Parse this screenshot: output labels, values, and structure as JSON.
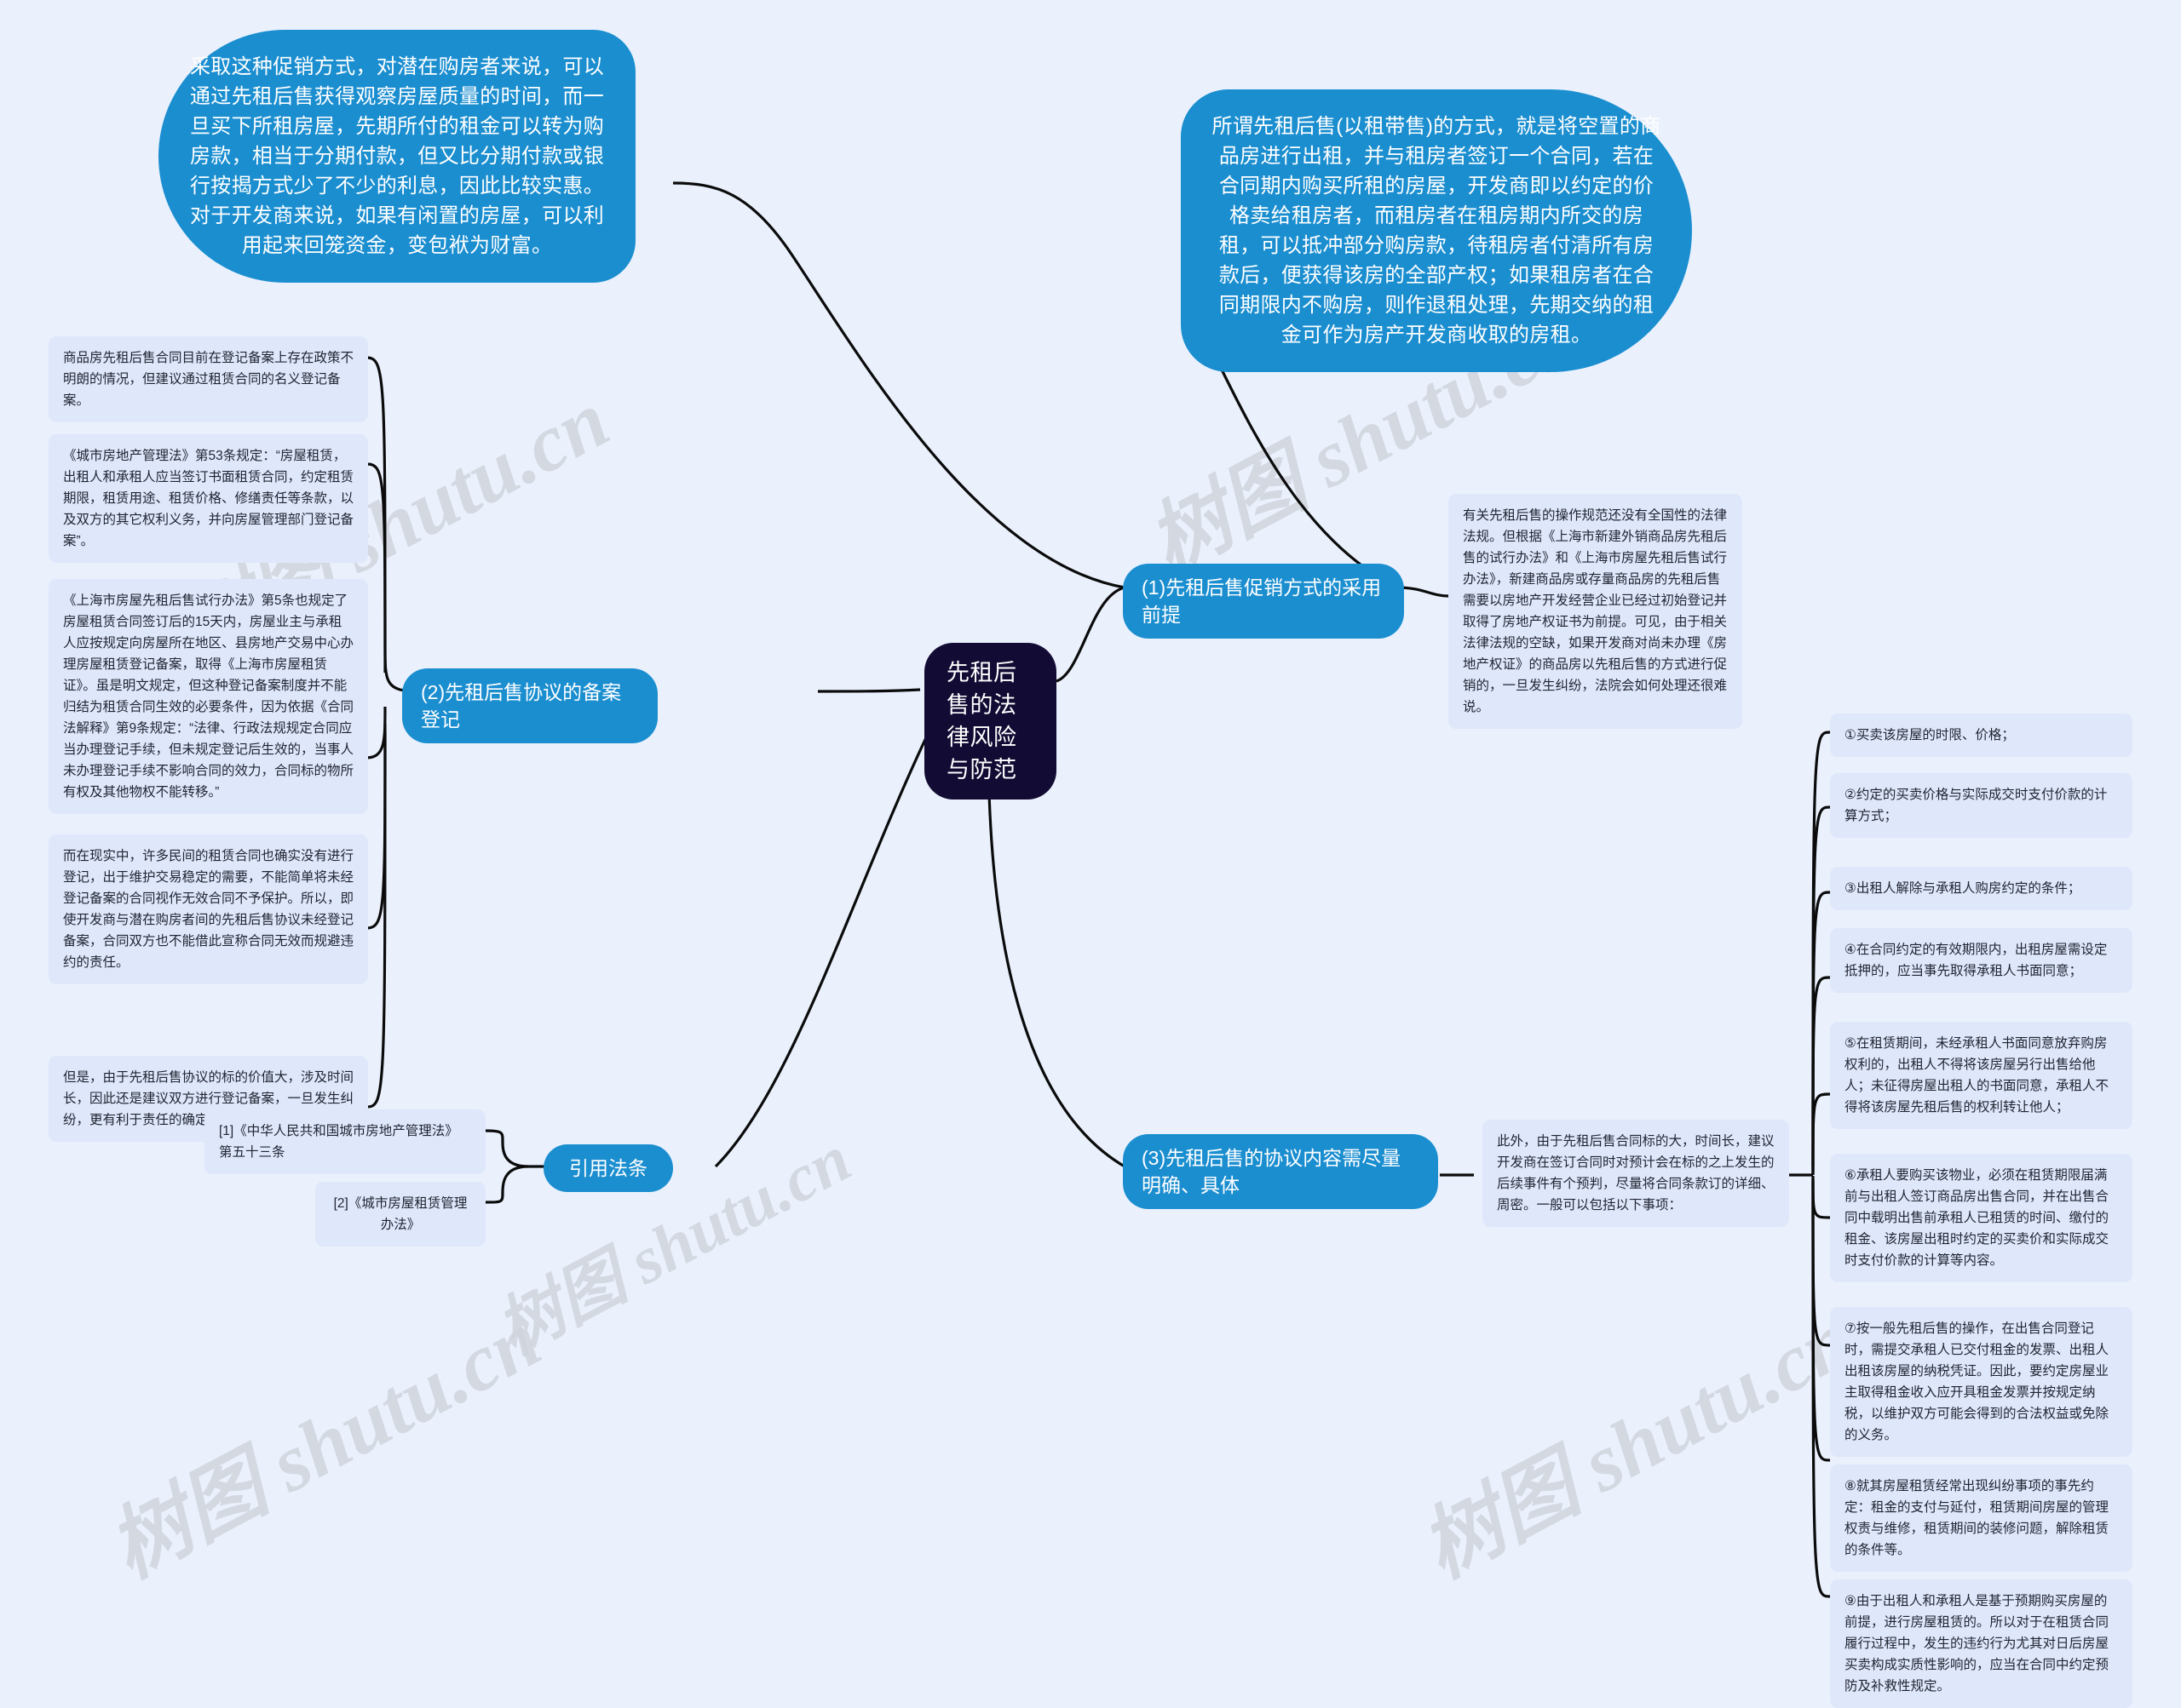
{
  "mindmap": {
    "title": "先租后售的法律风险与防范",
    "root": {
      "label": "先租后售的法律风险与防范"
    },
    "branches": {
      "b1": {
        "label": "(1)先租后售促销方式的采用前提"
      },
      "b2": {
        "label": "(2)先租后售协议的备案登记"
      },
      "b3": {
        "label": "(3)先租后售的协议内容需尽量明确、具体"
      },
      "b4": {
        "label": "引用法条"
      }
    },
    "bubbles": {
      "promo": "采取这种促销方式，对潜在购房者来说，可以通过先租后售获得观察房屋质量的时间，而一旦买下所租房屋，先期所付的租金可以转为购房款，相当于分期付款，但又比分期付款或银行按揭方式少了不少的利息，因此比较实惠。对于开发商来说，如果有闲置的房屋，可以利用起来回笼资金，变包袱为财富。",
      "definition": "所谓先租后售(以租带售)的方式，就是将空置的商品房进行出租，并与租房者签订一个合同，若在合同期内购买所租的房屋，开发商即以约定的价格卖给租房者，而租房者在租房期内所交的房租，可以抵冲部分购房款，待租房者付清所有房款后，便获得该房的全部产权；如果租房者在合同期限内不购房，则作退租处理，先期交纳的租金可作为房产开发商收取的房租。"
    },
    "filing_notes": [
      "商品房先租后售合同目前在登记备案上存在政策不明朗的情况，但建议通过租赁合同的名义登记备案。",
      "《城市房地产管理法》第53条规定：“房屋租赁，出租人和承租人应当签订书面租赁合同，约定租赁期限，租赁用途、租赁价格、修缮责任等条款，以及双方的其它权利义务，并向房屋管理部门登记备案”。",
      "《上海市房屋先租后售试行办法》第5条也规定了房屋租赁合同签订后的15天内，房屋业主与承租人应按规定向房屋所在地区、县房地产交易中心办理房屋租赁登记备案，取得《上海市房屋租赁证》。虽是明文规定，但这种登记备案制度并不能归结为租赁合同生效的必要条件，因为依据《合同法解释》第9条规定：“法律、行政法规规定合同应当办理登记手续，但未规定登记后生效的，当事人未办理登记手续不影响合同的效力，合同标的物所有权及其他物权不能转移。”",
      "而在现实中，许多民间的租赁合同也确实没有进行登记，出于维护交易稳定的需要，不能简单将未经登记备案的合同视作无效合同不予保护。所以，即使开发商与潜在购房者间的先租后售协议未经登记备案，合同双方也不能借此宣称合同无效而规避违约的责任。",
      "但是，由于先租后售协议的标的价值大，涉及时间长，因此还是建议双方进行登记备案，一旦发生纠纷，更有利于责任的确定与问题的解决。"
    ],
    "premise_note": "有关先租后售的操作规范还没有全国性的法律法规。但根据《上海市新建外销商品房先租后售的试行办法》和《上海市房屋先租后售试行办法》，新建商品房或存量商品房的先租后售需要以房地产开发经营企业已经过初始登记并取得了房地产权证书为前提。可见，由于相关法律法规的空缺，如果开发商对尚未办理《房地产权证》的商品房以先租后售的方式进行促销的，一旦发生纠纷，法院会如何处理还很难说。",
    "agreement_intro": "此外，由于先租后售合同标的大，时间长，建议开发商在签订合同时对预计会在标的之上发生的后续事件有个预判，尽量将合同条款订的详细、周密。一般可以包括以下事项：",
    "agreement_items": [
      "①买卖该房屋的时限、价格；",
      "②约定的买卖价格与实际成交时支付价款的计算方式；",
      "③出租人解除与承租人购房约定的条件；",
      "④在合同约定的有效期限内，出租房屋需设定抵押的，应当事先取得承租人书面同意；",
      "⑤在租赁期间，未经承租人书面同意放弃购房权利的，出租人不得将该房屋另行出售给他人；未征得房屋出租人的书面同意，承租人不得将该房屋先租后售的权利转让他人；",
      "⑥承租人要购买该物业，必须在租赁期限届满前与出租人签订商品房出售合同，并在出售合同中载明出售前承租人已租赁的时间、缴付的租金、该房屋出租时约定的买卖价和实际成交时支付价款的计算等内容。",
      "⑦按一般先租后售的操作，在出售合同登记时，需提交承租人已交付租金的发票、出租人出租该房屋的纳税凭证。因此，要约定房屋业主取得租金收入应开具租金发票并按规定纳税，以维护双方可能会得到的合法权益或免除的义务。",
      "⑧就其房屋租赁经常出现纠纷事项的事先约定：租金的支付与延付，租赁期间房屋的管理权责与维修，租赁期间的装修问题，解除租赁的条件等。",
      "⑨由于出租人和承租人是基于预期购买房屋的前提，进行房屋租赁的。所以对于在租赁合同履行过程中，发生的违约行为尤其对日后房屋买卖构成实质性影响的，应当在合同中约定预防及补救性规定。"
    ],
    "law_refs": [
      "[1]《中华人民共和国城市房地产管理法》 第五十三条",
      "[2]《城市房屋租赁管理办法》"
    ],
    "watermarks": [
      "树图 shutu.cn",
      "树图 shutu.cn",
      "树图 shutu.cn",
      "树图 shutu.cn",
      "树图 shutu.cn"
    ],
    "colors": {
      "background": "#eaf1fd",
      "root": "#120b33",
      "branch": "#1b8ed0",
      "bubble": "#1b8ed0",
      "leaf": "#dfe7fb",
      "link": "#0b0b0b"
    }
  }
}
